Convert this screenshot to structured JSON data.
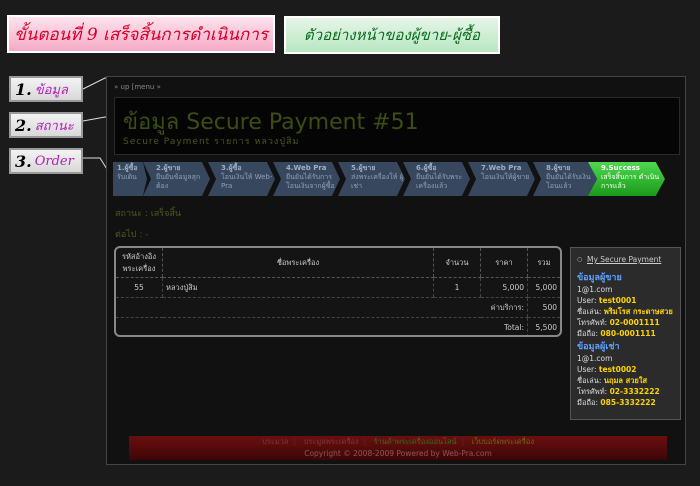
{
  "banners": {
    "step_title": "ขั้นตอนที่ 9  เสร็จสิ้นการดำเนินการ",
    "example_title": "ตัวอย่างหน้าของผู้ขาย-ผู้ซื้อ"
  },
  "callouts": [
    {
      "num": "1.",
      "label": "ข้อมูล"
    },
    {
      "num": "2.",
      "label": "สถานะ"
    },
    {
      "num": "3.",
      "label": "Order"
    }
  ],
  "page": {
    "breadcrumb": "» up [menu »",
    "title": "ข้อมูล Secure Payment #51",
    "subtitle": "Secure Payment รายการ หลวงปู่สิม",
    "status": "สถานะ : เสร็จสิ้น",
    "next": "ต่อไป : -"
  },
  "steps": [
    {
      "title": "1.ผู้ซื้อ",
      "desc": "รับเดิน"
    },
    {
      "title": "2.ผู้ขาย",
      "desc": "ยืนยันข้อมูลสุก ต้อง"
    },
    {
      "title": "3.ผู้ซื้อ",
      "desc": "โอนเงินให้ Web-Pra"
    },
    {
      "title": "4.Web Pra",
      "desc": "ยืนยันได้รับการ โอนเงินจากผู้ซื้อ"
    },
    {
      "title": "5.ผู้ขาย",
      "desc": "ส่งพระเครื่องให้ ผู้เช่า"
    },
    {
      "title": "6.ผู้ซื้อ",
      "desc": "ยืนยันได้รับพระ เครื่องแล้ว"
    },
    {
      "title": "7.Web Pra",
      "desc": "โอนเงินให้ผู้ขาย"
    },
    {
      "title": "8.ผู้ขาย",
      "desc": "ยืนยันได้รับเงิน โอนแล้ว"
    },
    {
      "title": "9.Success",
      "desc": "เสร็จสิ้นการ ดำเนินการแล้ว"
    }
  ],
  "order": {
    "headers": [
      "รหัสอ้างอิง พระเครื่อง",
      "ชื่อพระเครื่อง",
      "จำนวน",
      "ราคา",
      "รวม"
    ],
    "rows": [
      {
        "code": "55",
        "name": "หลวงปู่สิม",
        "qty": "1",
        "price": "5,000",
        "total": "5,000"
      }
    ],
    "fee_label": "ค่าบริการ:",
    "fee_value": "500",
    "total_label": "Total:",
    "total_value": "5,500"
  },
  "panel": {
    "link": "My Secure Payment",
    "seller_heading": "ข้อมูลผู้ขาย",
    "seller_email": "1@1.com",
    "seller_user_label": "User:",
    "seller_user": "test0001",
    "seller_name_label": "ชื่อเล่น:",
    "seller_name": "พริมโรส กระดาษสวย",
    "seller_phone_label": "โทรศัพท์:",
    "seller_phone": "02-0001111",
    "seller_mobile_label": "มือถือ:",
    "seller_mobile": "080-0001111",
    "buyer_heading": "ข้อมูลผู้เช่า",
    "buyer_email": "1@1.com",
    "buyer_user_label": "User:",
    "buyer_user": "test0002",
    "buyer_name_label": "ชื่อเล่น:",
    "buyer_name": "นฤมล สวยใส",
    "buyer_phone_label": "โทรศัพท์:",
    "buyer_phone": "02-3332222",
    "buyer_mobile_label": "มือถือ:",
    "buyer_mobile": "085-3332222"
  },
  "footer": {
    "links": [
      "ประมวล",
      "ประมูลพระเครื่อง",
      "ร้านค้าพระเครื่องออนไลน์",
      "เว็บบอร์ดพระเครื่อง"
    ],
    "copyright": "Copyright © 2008-2009 Powered by Web-Pra.com"
  }
}
